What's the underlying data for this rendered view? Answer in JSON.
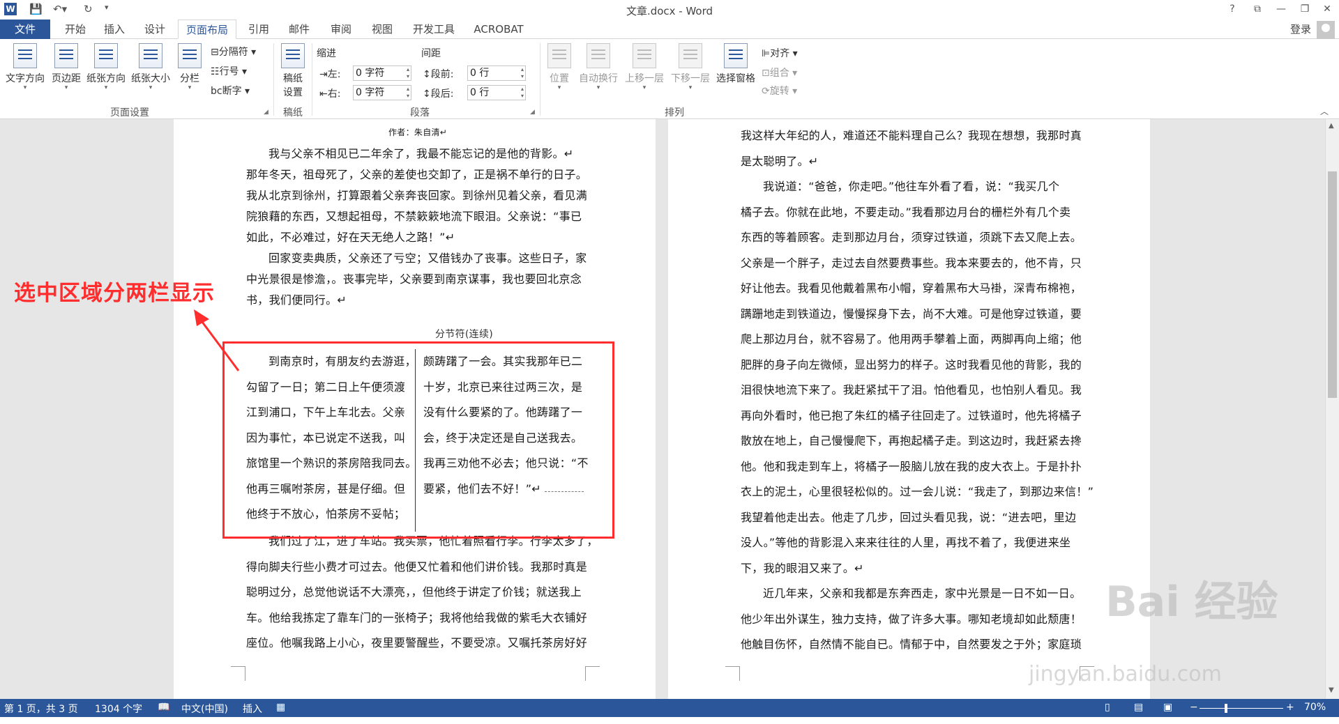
{
  "titlebar": {
    "title": "文章.docx - Word",
    "help": "?",
    "minimize": "—",
    "restore": "❐",
    "close": "✕"
  },
  "tabs": [
    "文件",
    "开始",
    "插入",
    "设计",
    "页面布局",
    "引用",
    "邮件",
    "审阅",
    "视图",
    "开发工具",
    "ACROBAT"
  ],
  "signin": "登录",
  "ribbon": {
    "page_setup": {
      "text_direction": "文字方向",
      "margins": "页边距",
      "orientation": "纸张方向",
      "size": "纸张大小",
      "columns": "分栏",
      "breaks": "分隔符",
      "line_numbers": "行号",
      "hyphenation": "断字",
      "label": "页面设置"
    },
    "draft": {
      "settings": "稿纸设置",
      "settings_l1": "稿纸",
      "settings_l2": "设置",
      "label": "稿纸"
    },
    "paragraph": {
      "indent_title": "缩进",
      "spacing_title": "间距",
      "left_label": "左:",
      "left_value": "0 字符",
      "right_label": "右:",
      "right_value": "0 字符",
      "before_label": "段前:",
      "before_value": "0 行",
      "after_label": "段后:",
      "after_value": "0 行",
      "label": "段落"
    },
    "arrange": {
      "position": "位置",
      "wrap": "自动换行",
      "forward": "上移一层",
      "backward": "下移一层",
      "selection_pane": "选择窗格",
      "align": "对齐",
      "group": "组合",
      "rotate": "旋转",
      "label": "排列"
    }
  },
  "document": {
    "left_page": {
      "author": "作者：朱自清↵",
      "lines_top": [
        "我与父亲不相见已二年余了，我最不能忘记的是他的背影。↵",
        "那年冬天，祖母死了，父亲的差使也交卸了，正是祸不单行的日子。",
        "我从北京到徐州，打算跟着父亲奔丧回家。到徐州见着父亲，看见满",
        "院狼藉的东西，又想起祖母，不禁簌簌地流下眼泪。父亲说：“事已",
        "如此，不必难过，好在天无绝人之路！”↵",
        "回家变卖典质，父亲还了亏空；又借钱办了丧事。这些日子，家",
        "中光景很是惨澹，。丧事完毕，父亲要到南京谋事，我也要回北京念",
        "书，我们便同行。↵"
      ],
      "section_break": "分节符(连续)",
      "col1": [
        "到南京时，有朋友约去游逛，",
        "勾留了一日；第二日上午便须渡",
        "江到浦口，下午上车北去。父亲",
        "因为事忙，本已说定不送我，叫",
        "旅馆里一个熟识的茶房陪我同去。",
        "他再三嘱咐茶房，甚是仔细。但",
        "他终于不放心，怕茶房不妥帖；"
      ],
      "col2": [
        "颇踌躇了一会。其实我那年已二",
        "十岁，北京已来往过两三次，是",
        "没有什么要紧的了。他踌躇了一",
        "会，终于决定还是自己送我去。",
        "我再三劝他不必去；他只说：“不",
        "要紧，他们去不好！”↵"
      ],
      "lines_bottom": [
        "我们过了江，进了车站。我买票，他忙着照看行李。行李太多了，",
        "得向脚夫行些小费才可过去。他便又忙着和他们讲价钱。我那时真是",
        "聪明过分，总觉他说话不大漂亮，，但他终于讲定了价钱；就送我上",
        "车。他给我拣定了靠车门的一张椅子；我将他给我做的紫毛大衣铺好",
        "座位。他嘱我路上小心，夜里要警醒些，不要受凉。又嘱托茶房好好"
      ]
    },
    "right_page": {
      "lines": [
        "我这样大年纪的人，难道还不能料理自己么？我现在想想，我那时真",
        "是太聪明了。↵",
        "我说道：“爸爸，你走吧。”他往车外看了看，说：“我买几个",
        "橘子去。你就在此地，不要走动。”我看那边月台的栅栏外有几个卖",
        "东西的等着顾客。走到那边月台，须穿过铁道，须跳下去又爬上去。",
        "父亲是一个胖子，走过去自然要费事些。我本来要去的，他不肯，只",
        "好让他去。我看见他戴着黑布小帽，穿着黑布大马褂，深青布棉袍，",
        "蹒跚地走到铁道边，慢慢探身下去，尚不大难。可是他穿过铁道，要",
        "爬上那边月台，就不容易了。他用两手攀着上面，两脚再向上缩；他",
        "肥胖的身子向左微倾，显出努力的样子。这时我看见他的背影，我的",
        "泪很快地流下来了。我赶紧拭干了泪。怕他看见，也怕别人看见。我",
        "再向外看时，他已抱了朱红的橘子往回走了。过铁道时，他先将橘子",
        "散放在地上，自己慢慢爬下，再抱起橘子走。到这边时，我赶紧去搀",
        "他。他和我走到车上，将橘子一股脑儿放在我的皮大衣上。于是扑扑",
        "衣上的泥土，心里很轻松似的。过一会儿说：“我走了，到那边来信！”",
        "我望着他走出去。他走了几步，回过头看见我，说：“进去吧，里边",
        "没人。”等他的背影混入来来往往的人里，再找不着了，我便进来坐",
        "下，我的眼泪又来了。↵",
        "近几年来，父亲和我都是东奔西走，家中光景是一日不如一日。",
        "他少年出外谋生，独力支持，做了许多大事。哪知老境却如此颓唐！",
        "他触目伤怀，自然情不能自已。情郁于中，自然要发之于外；家庭琐"
      ]
    }
  },
  "annotation": "选中区域分两栏显示",
  "watermark": {
    "brand": "Bai 经验",
    "url": "jingyan.baidu.com"
  },
  "statusbar": {
    "page": "第 1 页，共 3 页",
    "words": "1304 个字",
    "language": "中文(中国)",
    "mode": "插入",
    "zoom": "70%"
  }
}
